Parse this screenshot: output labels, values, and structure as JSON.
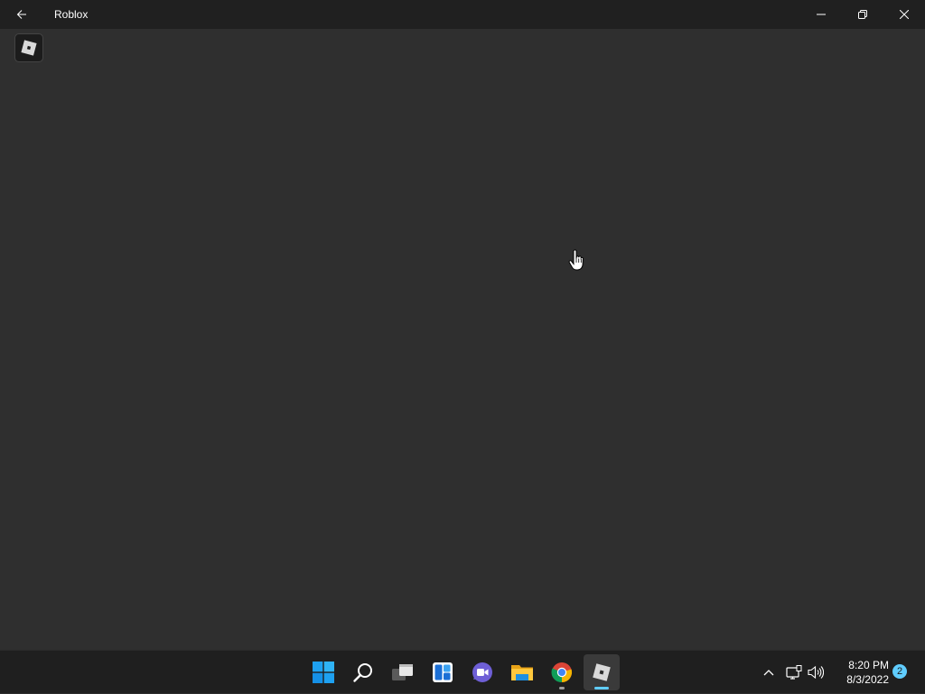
{
  "window": {
    "title": "Roblox"
  },
  "icons": {
    "back": "arrow-left-icon",
    "minimize": "minimize-icon",
    "restore": "restore-icon",
    "close": "close-icon",
    "app_logo": "roblox-logo-icon"
  },
  "taskbar": {
    "apps": [
      {
        "name": "Start",
        "icon": "windows-start-icon"
      },
      {
        "name": "Search",
        "icon": "search-icon"
      },
      {
        "name": "Task View",
        "icon": "task-view-icon"
      },
      {
        "name": "Widgets",
        "icon": "widgets-icon"
      },
      {
        "name": "Chat",
        "icon": "chat-icon"
      },
      {
        "name": "File Explorer",
        "icon": "folder-icon"
      },
      {
        "name": "Google Chrome",
        "icon": "chrome-icon",
        "open": true
      },
      {
        "name": "Roblox",
        "icon": "roblox-icon",
        "active": true
      }
    ],
    "tray": {
      "time": "8:20 PM",
      "date": "8/3/2022",
      "notification_count": "2"
    }
  },
  "colors": {
    "titlebar": "#202020",
    "app_background": "#2f2f2f",
    "taskbar": "#1f1f1f",
    "accent": "#60cdff"
  }
}
